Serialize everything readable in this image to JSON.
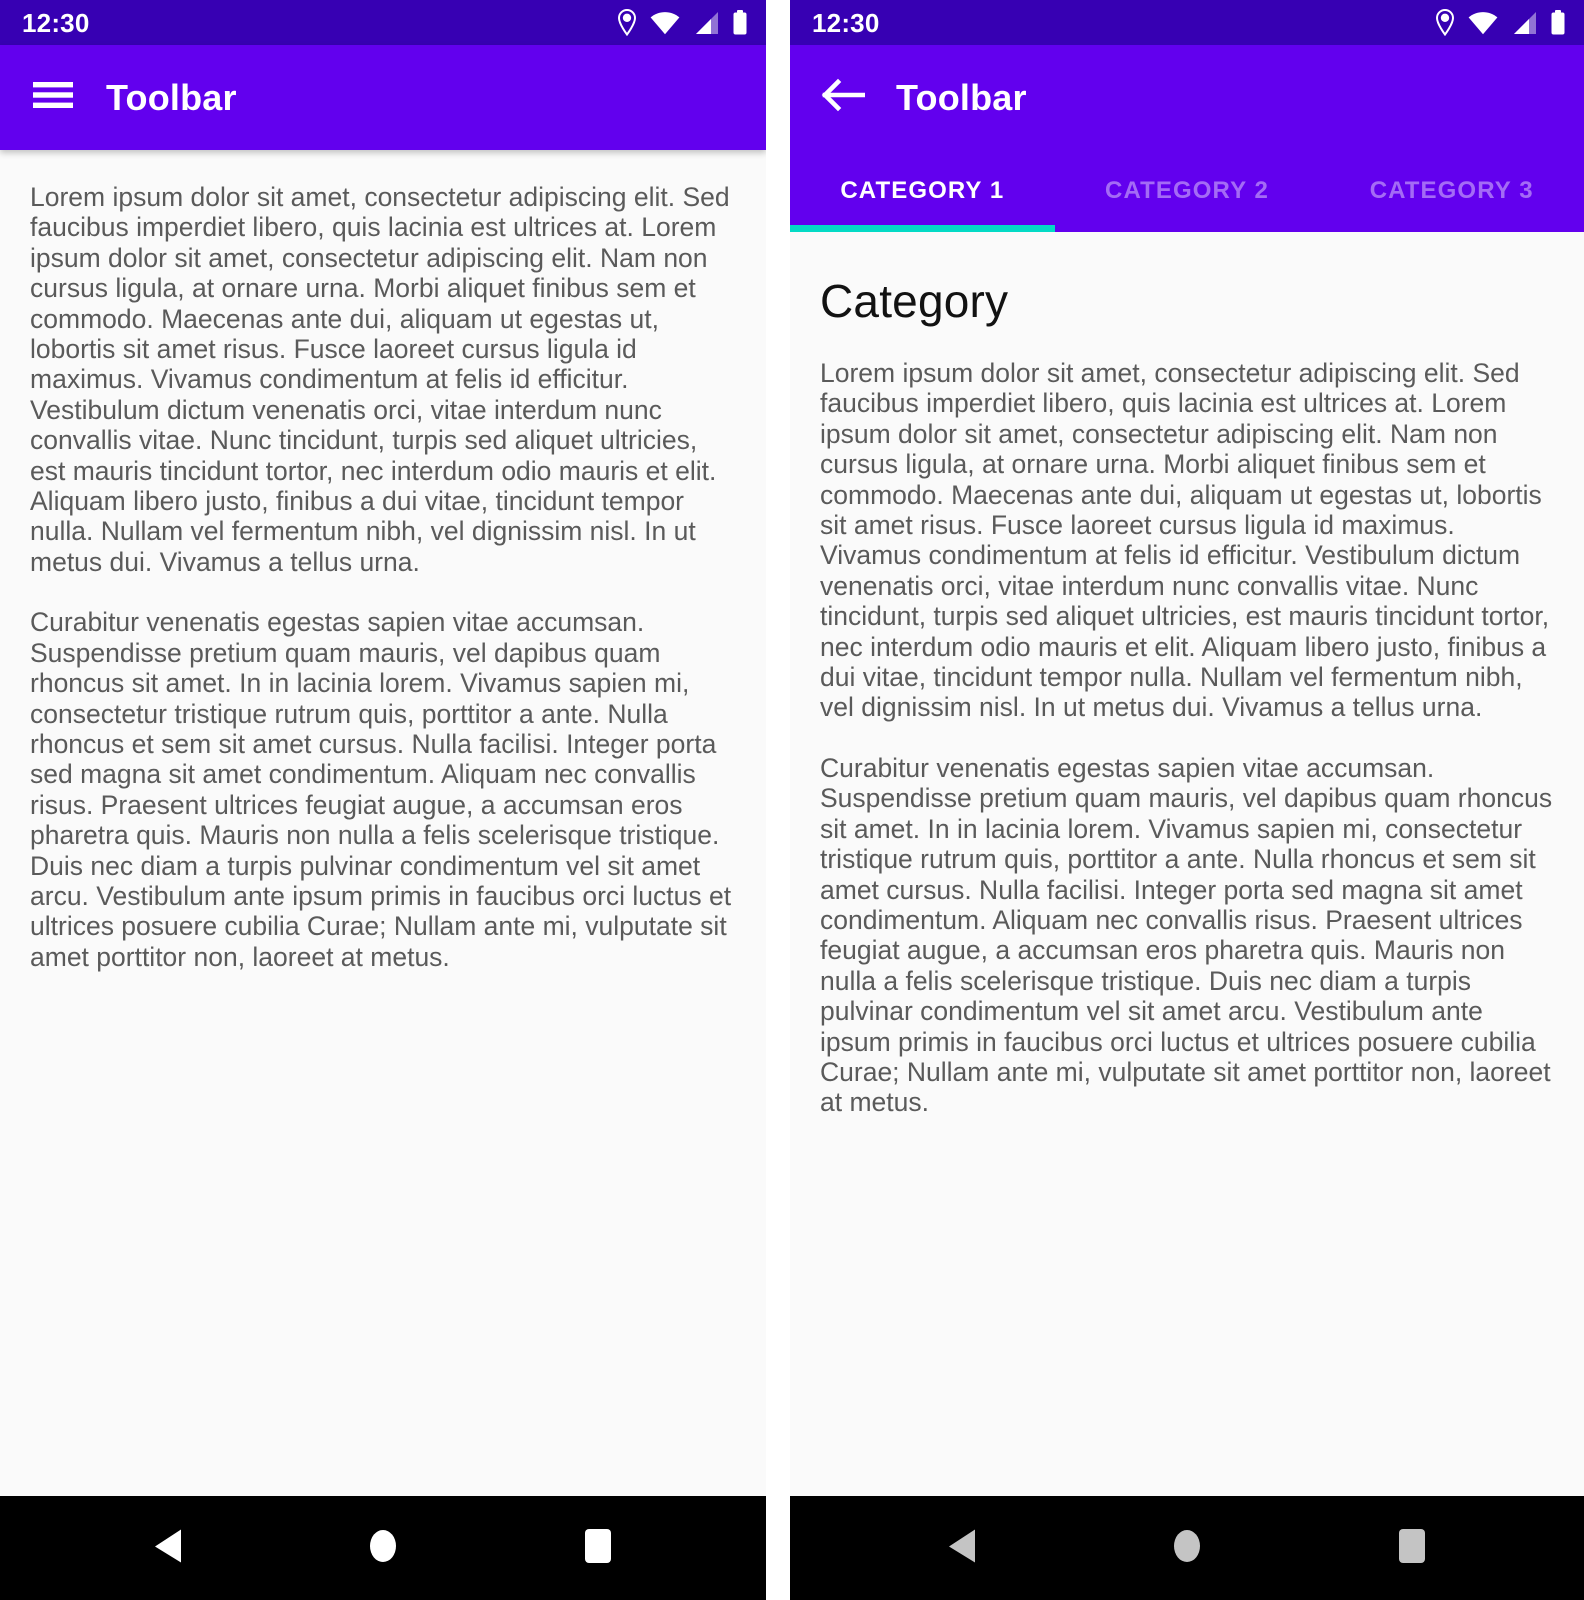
{
  "screens": [
    {
      "id": "drawer-screen",
      "statusbar": {
        "time": "12:30",
        "icons": [
          "location-icon",
          "wifi-icon",
          "signal-icon",
          "battery-icon"
        ]
      },
      "toolbar": {
        "nav_icon": "hamburger-menu-icon",
        "title": "Toolbar"
      },
      "content": {
        "paragraphs": [
          "Lorem ipsum dolor sit amet, consectetur adipiscing elit. Sed faucibus imperdiet libero, quis lacinia est ultrices at. Lorem ipsum dolor sit amet, consectetur adipiscing elit. Nam non cursus ligula, at ornare urna. Morbi aliquet finibus sem et commodo. Maecenas ante dui, aliquam ut egestas ut, lobortis sit amet risus. Fusce laoreet cursus ligula id maximus. Vivamus condimentum at felis id efficitur. Vestibulum dictum venenatis orci, vitae interdum nunc convallis vitae. Nunc tincidunt, turpis sed aliquet ultricies, est mauris tincidunt tortor, nec interdum odio mauris et elit. Aliquam libero justo, finibus a dui vitae, tincidunt tempor nulla. Nullam vel fermentum nibh, vel dignissim nisl. In ut metus dui. Vivamus a tellus urna.",
          "Curabitur venenatis egestas sapien vitae accumsan. Suspendisse pretium quam mauris, vel dapibus quam rhoncus sit amet. In in lacinia lorem. Vivamus sapien mi, consectetur tristique rutrum quis, porttitor a ante. Nulla rhoncus et sem sit amet cursus. Nulla facilisi. Integer porta sed magna sit amet condimentum. Aliquam nec convallis risus. Praesent ultrices feugiat augue, a accumsan eros pharetra quis. Mauris non nulla a felis scelerisque tristique. Duis nec diam a turpis pulvinar condimentum vel sit amet arcu. Vestibulum ante ipsum primis in faucibus orci luctus et ultrices posuere cubilia Curae; Nullam ante mi, vulputate sit amet porttitor non, laoreet at metus."
        ]
      },
      "navbar": {
        "keys": [
          "back-triangle-icon",
          "home-circle-icon",
          "recents-square-icon"
        ],
        "icon_color": "#ffffff"
      }
    },
    {
      "id": "tabs-screen",
      "statusbar": {
        "time": "12:30",
        "icons": [
          "location-icon",
          "wifi-icon",
          "signal-icon",
          "battery-icon"
        ]
      },
      "toolbar": {
        "nav_icon": "back-arrow-icon",
        "title": "Toolbar"
      },
      "tabs": [
        {
          "label": "CATEGORY 1",
          "active": true
        },
        {
          "label": "CATEGORY 2",
          "active": false
        },
        {
          "label": "CATEGORY 3",
          "active": false
        }
      ],
      "content": {
        "heading": "Category",
        "paragraphs": [
          "Lorem ipsum dolor sit amet, consectetur adipiscing elit. Sed faucibus imperdiet libero, quis lacinia est ultrices at. Lorem ipsum dolor sit amet, consectetur adipiscing elit. Nam non cursus ligula, at ornare urna. Morbi aliquet finibus sem et commodo. Maecenas ante dui, aliquam ut egestas ut, lobortis sit amet risus. Fusce laoreet cursus ligula id maximus. Vivamus condimentum at felis id efficitur. Vestibulum dictum venenatis orci, vitae interdum nunc convallis vitae. Nunc tincidunt, turpis sed aliquet ultricies, est mauris tincidunt tortor, nec interdum odio mauris et elit. Aliquam libero justo, finibus a dui vitae, tincidunt tempor nulla. Nullam vel fermentum nibh, vel dignissim nisl. In ut metus dui. Vivamus a tellus urna.",
          "Curabitur venenatis egestas sapien vitae accumsan. Suspendisse pretium quam mauris, vel dapibus quam rhoncus sit amet. In in lacinia lorem. Vivamus sapien mi, consectetur tristique rutrum quis, porttitor a ante. Nulla rhoncus et sem sit amet cursus. Nulla facilisi. Integer porta sed magna sit amet condimentum. Aliquam nec convallis risus. Praesent ultrices feugiat augue, a accumsan eros pharetra quis. Mauris non nulla a felis scelerisque tristique. Duis nec diam a turpis pulvinar condimentum vel sit amet arcu. Vestibulum ante ipsum primis in faucibus orci luctus et ultrices posuere cubilia Curae; Nullam ante mi, vulputate sit amet porttitor non, laoreet at metus."
        ]
      },
      "navbar": {
        "keys": [
          "back-triangle-icon",
          "home-circle-icon",
          "recents-square-icon"
        ],
        "icon_color": "#c4c4c4"
      }
    }
  ],
  "colors": {
    "status_bar": "#3700B3",
    "toolbar": "#6200EE",
    "tab_indicator": "#03DAC5",
    "content_background": "#fafafa",
    "body_text": "#5a5a5a",
    "heading_text": "#121212",
    "nav_background": "#000000"
  }
}
